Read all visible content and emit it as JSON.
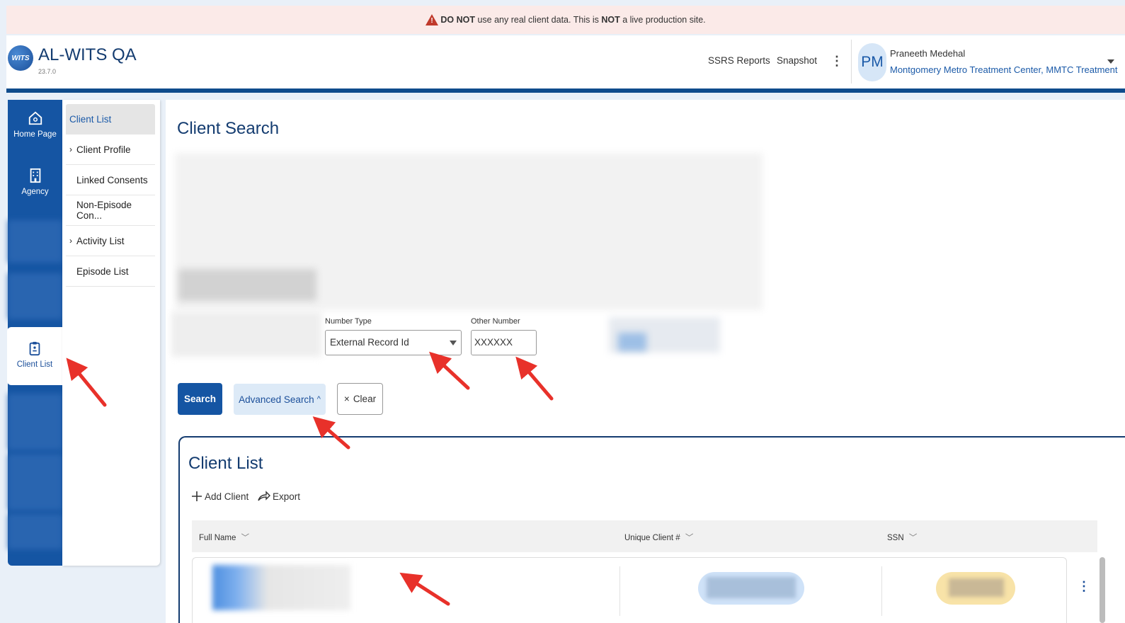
{
  "warning": {
    "strong1": "DO NOT",
    "text1": " use any real client data. This is ",
    "strong2": "NOT",
    "text2": " a live production site."
  },
  "header": {
    "logo_text": "WITS",
    "app_title": "AL-WITS QA",
    "version": "23.7.0",
    "links": [
      "SSRS Reports",
      "Snapshot"
    ],
    "user_initials": "PM",
    "user_name": "Praneeth Medehal",
    "user_org": "Montgomery Metro Treatment Center, MMTC Treatment"
  },
  "rail": {
    "home": "Home Page",
    "agency": "Agency",
    "client_list": "Client List"
  },
  "submenu": {
    "items": [
      {
        "label": "Client List",
        "chevron": ""
      },
      {
        "label": "Client Profile",
        "chevron": "›"
      },
      {
        "label": "Linked Consents",
        "chevron": ""
      },
      {
        "label": "Non-Episode Con...",
        "chevron": ""
      },
      {
        "label": "Activity List",
        "chevron": "›"
      },
      {
        "label": "Episode List",
        "chevron": ""
      }
    ]
  },
  "search": {
    "title": "Client Search",
    "number_type_label": "Number Type",
    "number_type_value": "External Record Id",
    "other_number_label": "Other Number",
    "other_number_value": "XXXXXX",
    "search_btn": "Search",
    "advanced_btn": "Advanced Search",
    "advanced_caret": "^",
    "clear_icon": "×",
    "clear_btn": "Clear"
  },
  "client_list": {
    "title": "Client List",
    "add_label": "Add Client",
    "export_label": "Export",
    "columns": [
      "Full Name",
      "Unique Client #",
      "SSN"
    ]
  },
  "colors": {
    "brand": "#1555a3",
    "title": "#143c70",
    "arrow": "#e8312a"
  }
}
